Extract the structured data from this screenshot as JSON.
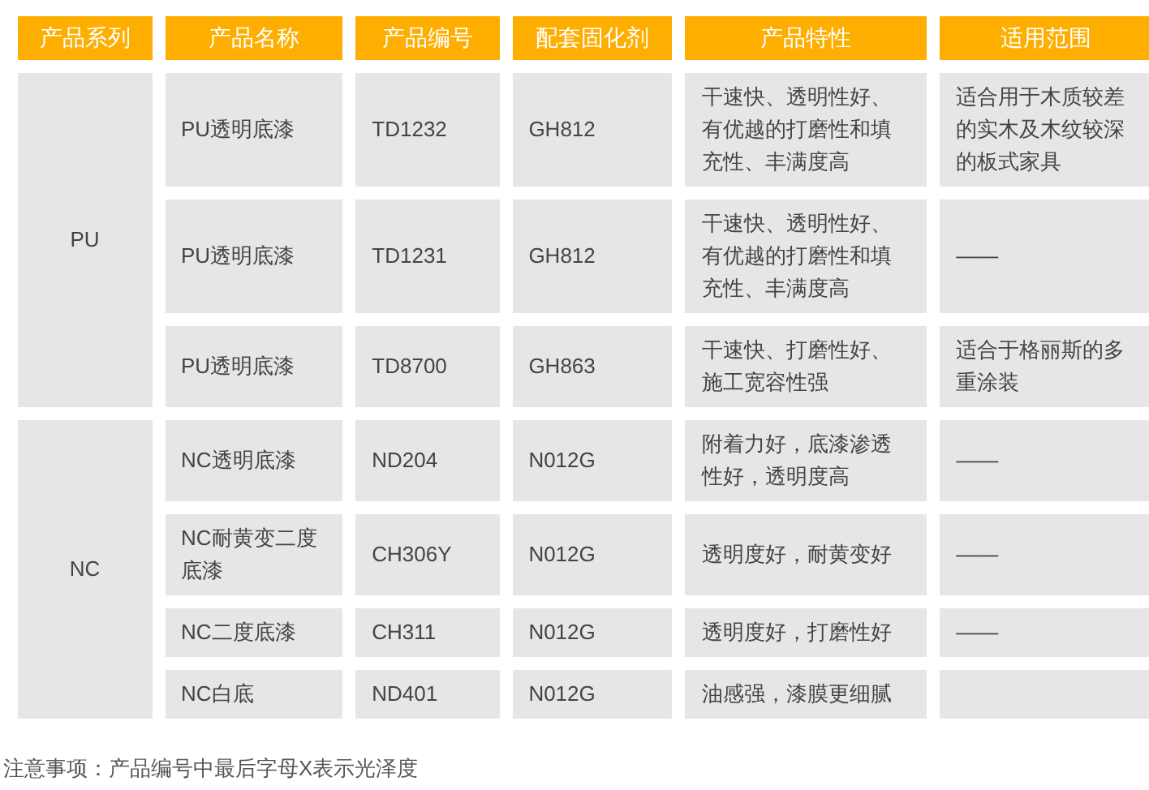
{
  "table": {
    "columns": [
      "产品系列",
      "产品名称",
      "产品编号",
      "配套固化剂",
      "产品特性",
      "适用范围"
    ],
    "groups": [
      {
        "series": "PU",
        "rows": [
          {
            "name": "PU透明底漆",
            "code": "TD1232",
            "hardener": "GH812",
            "features": "干速快、透明性好、有优越的打磨性和填充性、丰满度高",
            "scope": "适合用于木质较差的实木及木纹较深的板式家具"
          },
          {
            "name": "PU透明底漆",
            "code": "TD1231",
            "hardener": "GH812",
            "features": "干速快、透明性好、有优越的打磨性和填充性、丰满度高",
            "scope": "——"
          },
          {
            "name": "PU透明底漆",
            "code": "TD8700",
            "hardener": "GH863",
            "features": "干速快、打磨性好、施工宽容性强",
            "scope": "适合于格丽斯的多重涂装"
          }
        ]
      },
      {
        "series": "NC",
        "rows": [
          {
            "name": "NC透明底漆",
            "code": "ND204",
            "hardener": "N012G",
            "features": "附着力好，底漆渗透性好，透明度高",
            "scope": "——"
          },
          {
            "name": "NC耐黄变二度底漆",
            "code": "CH306Y",
            "hardener": "N012G",
            "features": "透明度好，耐黄变好",
            "scope": "——"
          },
          {
            "name": "NC二度底漆",
            "code": "CH311",
            "hardener": "N012G",
            "features": "透明度好，打磨性好",
            "scope": "——"
          },
          {
            "name": "NC白底",
            "code": "ND401",
            "hardener": "N012G",
            "features": "油感强，漆膜更细腻"
          }
        ]
      }
    ]
  },
  "note": "注意事项：产品编号中最后字母X表示光泽度"
}
